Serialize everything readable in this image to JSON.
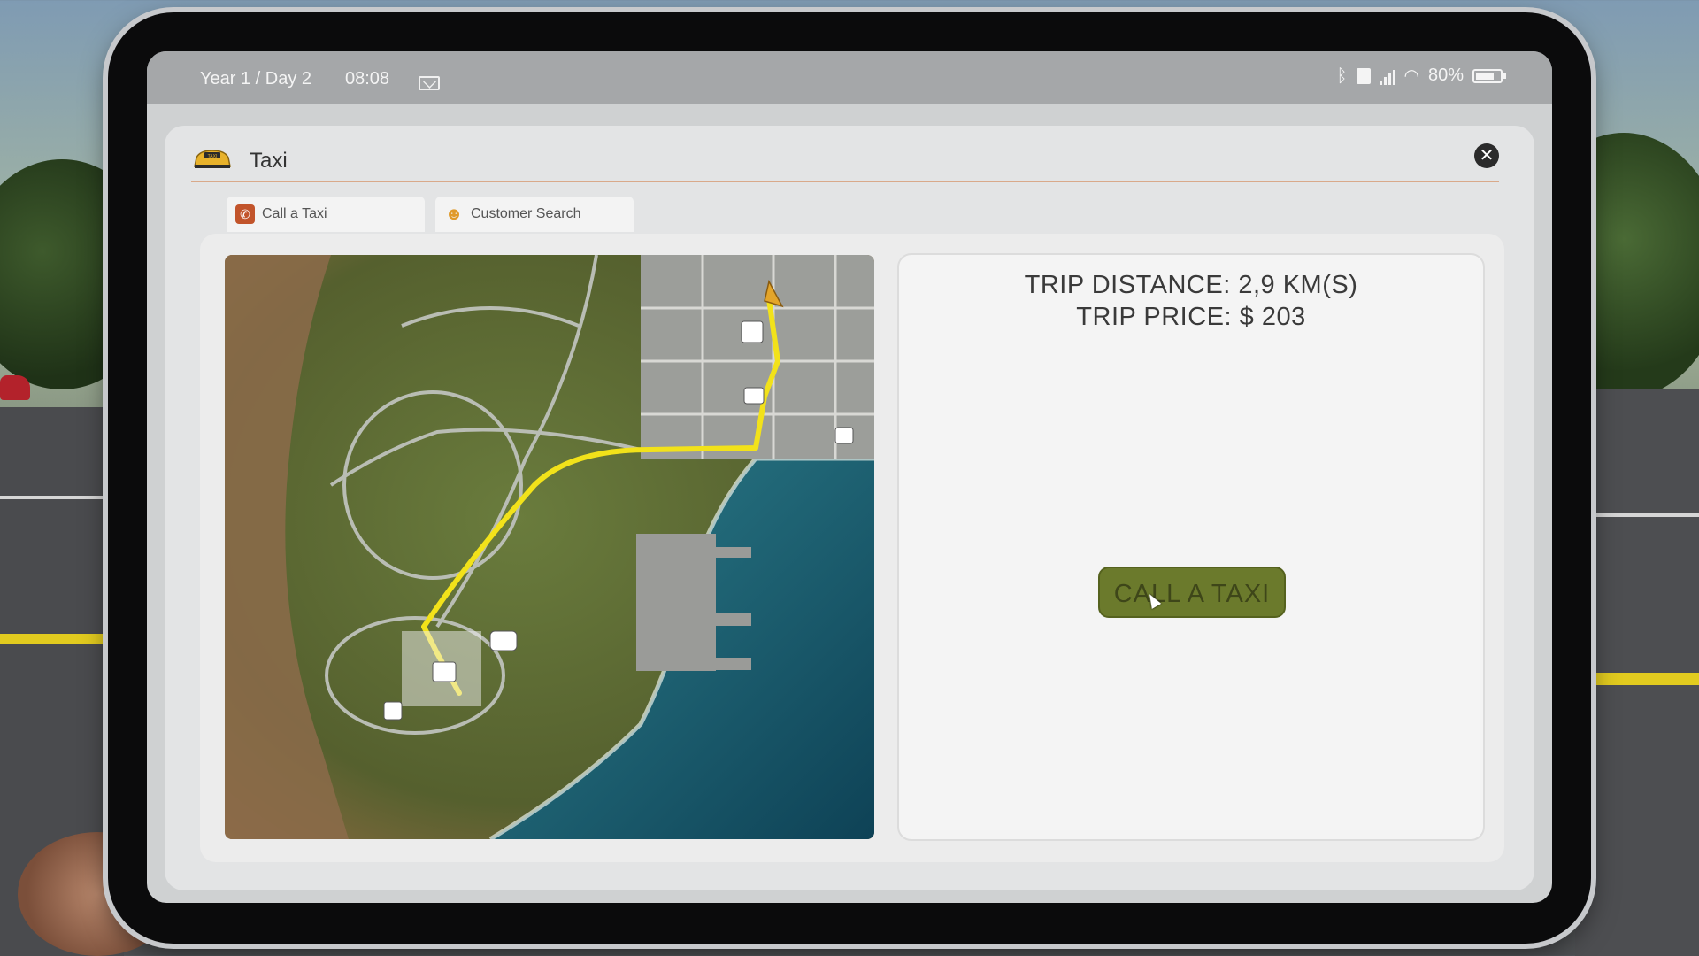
{
  "status": {
    "date": "Year 1 / Day 2",
    "time": "08:08",
    "battery": "80%",
    "battery_level": 0.8,
    "icons": [
      "mail-icon",
      "bluetooth-icon",
      "sim-icon",
      "signal-icon",
      "wifi-icon",
      "battery-icon"
    ]
  },
  "app": {
    "title": "Taxi",
    "icon": "taxi-icon",
    "close_icon": "close-icon"
  },
  "tabs": [
    {
      "label": "Call a Taxi",
      "icon": "phone-icon",
      "active": true
    },
    {
      "label": "Customer Search",
      "icon": "person-icon",
      "active": false
    }
  ],
  "trip": {
    "distance": "TRIP DISTANCE: 2,9 KM(S)",
    "price": "TRIP PRICE: $ 203"
  },
  "call_button": "CALL A TAXI",
  "colors": {
    "accent": "#6b7a2c",
    "route": "#f2e21a",
    "close": "#2b2b2b"
  }
}
